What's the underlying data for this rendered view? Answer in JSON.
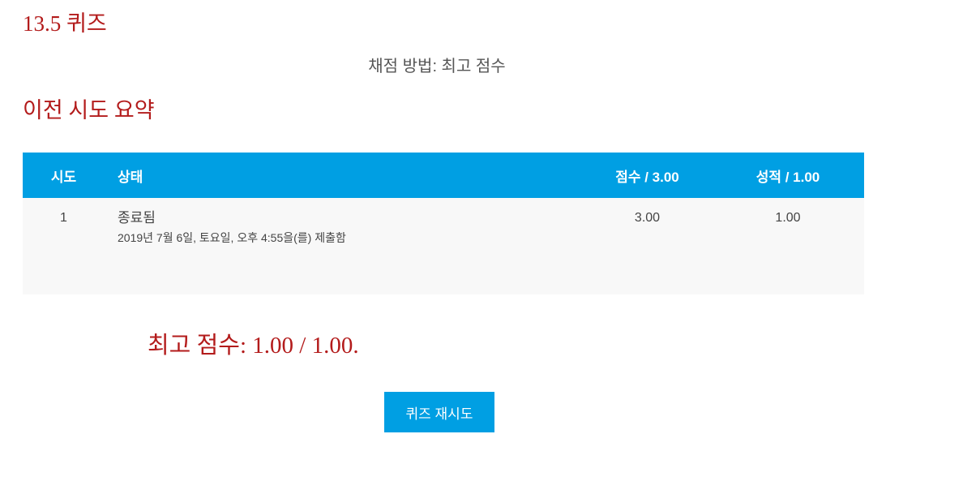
{
  "page": {
    "title": "13.5 퀴즈"
  },
  "grading": {
    "method_text": "채점 방법: 최고 점수"
  },
  "summary": {
    "title": "이전 시도 요약",
    "headers": {
      "attempt": "시도",
      "state": "상태",
      "marks": "점수 / 3.00",
      "grade": "성적 / 1.00"
    },
    "rows": [
      {
        "attempt": "1",
        "state": "종료됨",
        "submitted": "2019년 7월 6일, 토요일, 오후 4:55을(를) 제출함",
        "marks": "3.00",
        "grade": "1.00"
      }
    ]
  },
  "result": {
    "highest_grade_text": "최고 점수: 1.00 / 1.00."
  },
  "actions": {
    "reattempt_label": "퀴즈 재시도"
  },
  "colors": {
    "heading": "#b31b1b",
    "accent": "#009fe3",
    "row_background": "#f8f8f8"
  }
}
